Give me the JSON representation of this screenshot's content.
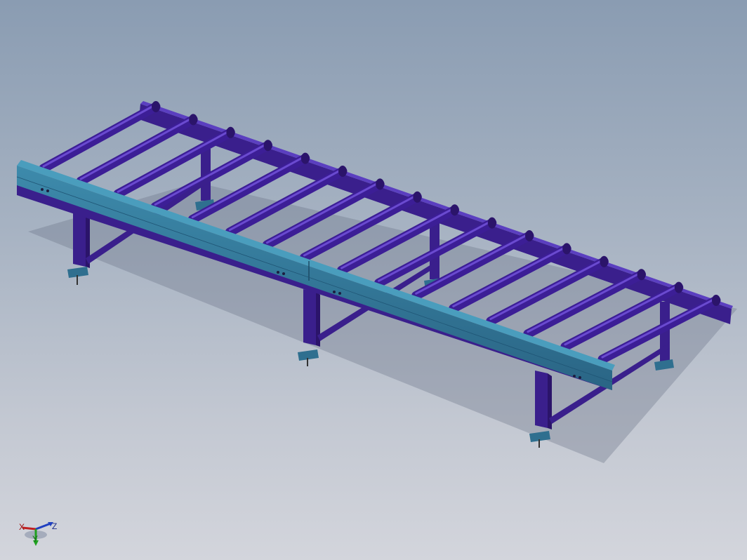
{
  "viewport": {
    "background_top": "#8a9cb2",
    "background_bottom": "#d3d5dc"
  },
  "model": {
    "name": "roller-conveyor-table",
    "frame_color": "#3a1f8c",
    "rail_color": "#2f6f8f",
    "roller_color": "#4b2aa6",
    "roller_count": 16,
    "leg_count": 6
  },
  "triad": {
    "x_label": "X",
    "y_label": "Y",
    "z_label": "Z"
  }
}
